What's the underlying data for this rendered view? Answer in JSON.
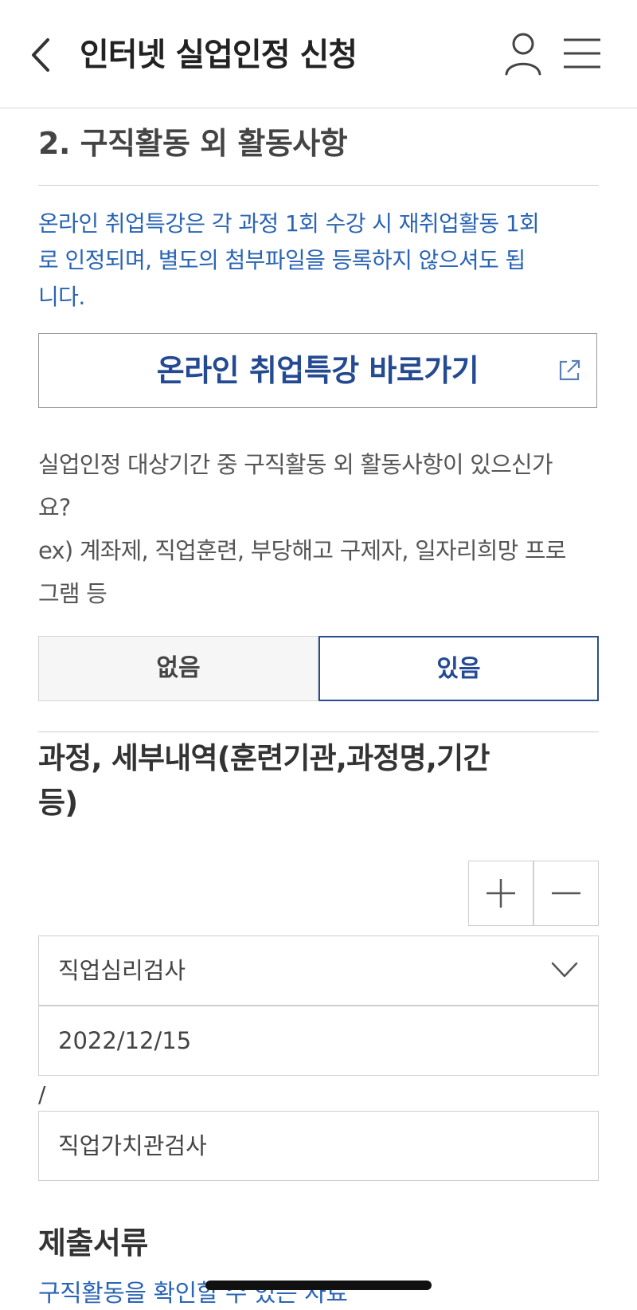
{
  "header": {
    "title": "인터넷 실업인정 신청",
    "icons": {
      "back": "chevron-left-icon",
      "user": "user-icon",
      "menu": "hamburger-menu-icon"
    }
  },
  "section": {
    "title": "2. 구직활동 외 활동사항",
    "notice_lines": [
      "온라인 취업특강은 각 과정 1회 수강 시 재취업활동 1회",
      "로 인정되며, 별도의 첨부파일을 등록하지 않으셔도 됩",
      "니다."
    ],
    "link_button": {
      "label": "온라인 취업특강 바로가기",
      "icon": "external-link-icon"
    }
  },
  "question": {
    "lines": [
      "실업인정 대상기간 중 구직활동 외 활동사항이 있으신가",
      "요?",
      "ex) 계좌제, 직업훈련, 부당해고 구제자, 일자리희망 프로",
      "그램 등"
    ],
    "options": [
      {
        "label": "없음",
        "selected": false
      },
      {
        "label": "있음",
        "selected": true
      }
    ]
  },
  "details": {
    "title_lines": [
      "과정, 세부내역(훈련기관,과정명,기간",
      "등)"
    ],
    "stepper": {
      "add_icon": "plus-icon",
      "remove_icon": "minus-icon"
    },
    "type_select": {
      "value": "직업심리검사",
      "icon": "chevron-down-icon"
    },
    "date_field": {
      "value": "2022/12/15"
    },
    "separator": "/",
    "name_field": {
      "value": "직업가치관검사"
    }
  },
  "documents": {
    "title": "제출서류",
    "link_partial": "구직활동을 확인할 수 있는 자료"
  },
  "colors": {
    "accent_blue": "#2a64b4",
    "brand_navy": "#234a92",
    "border": "#cfcfcf"
  }
}
